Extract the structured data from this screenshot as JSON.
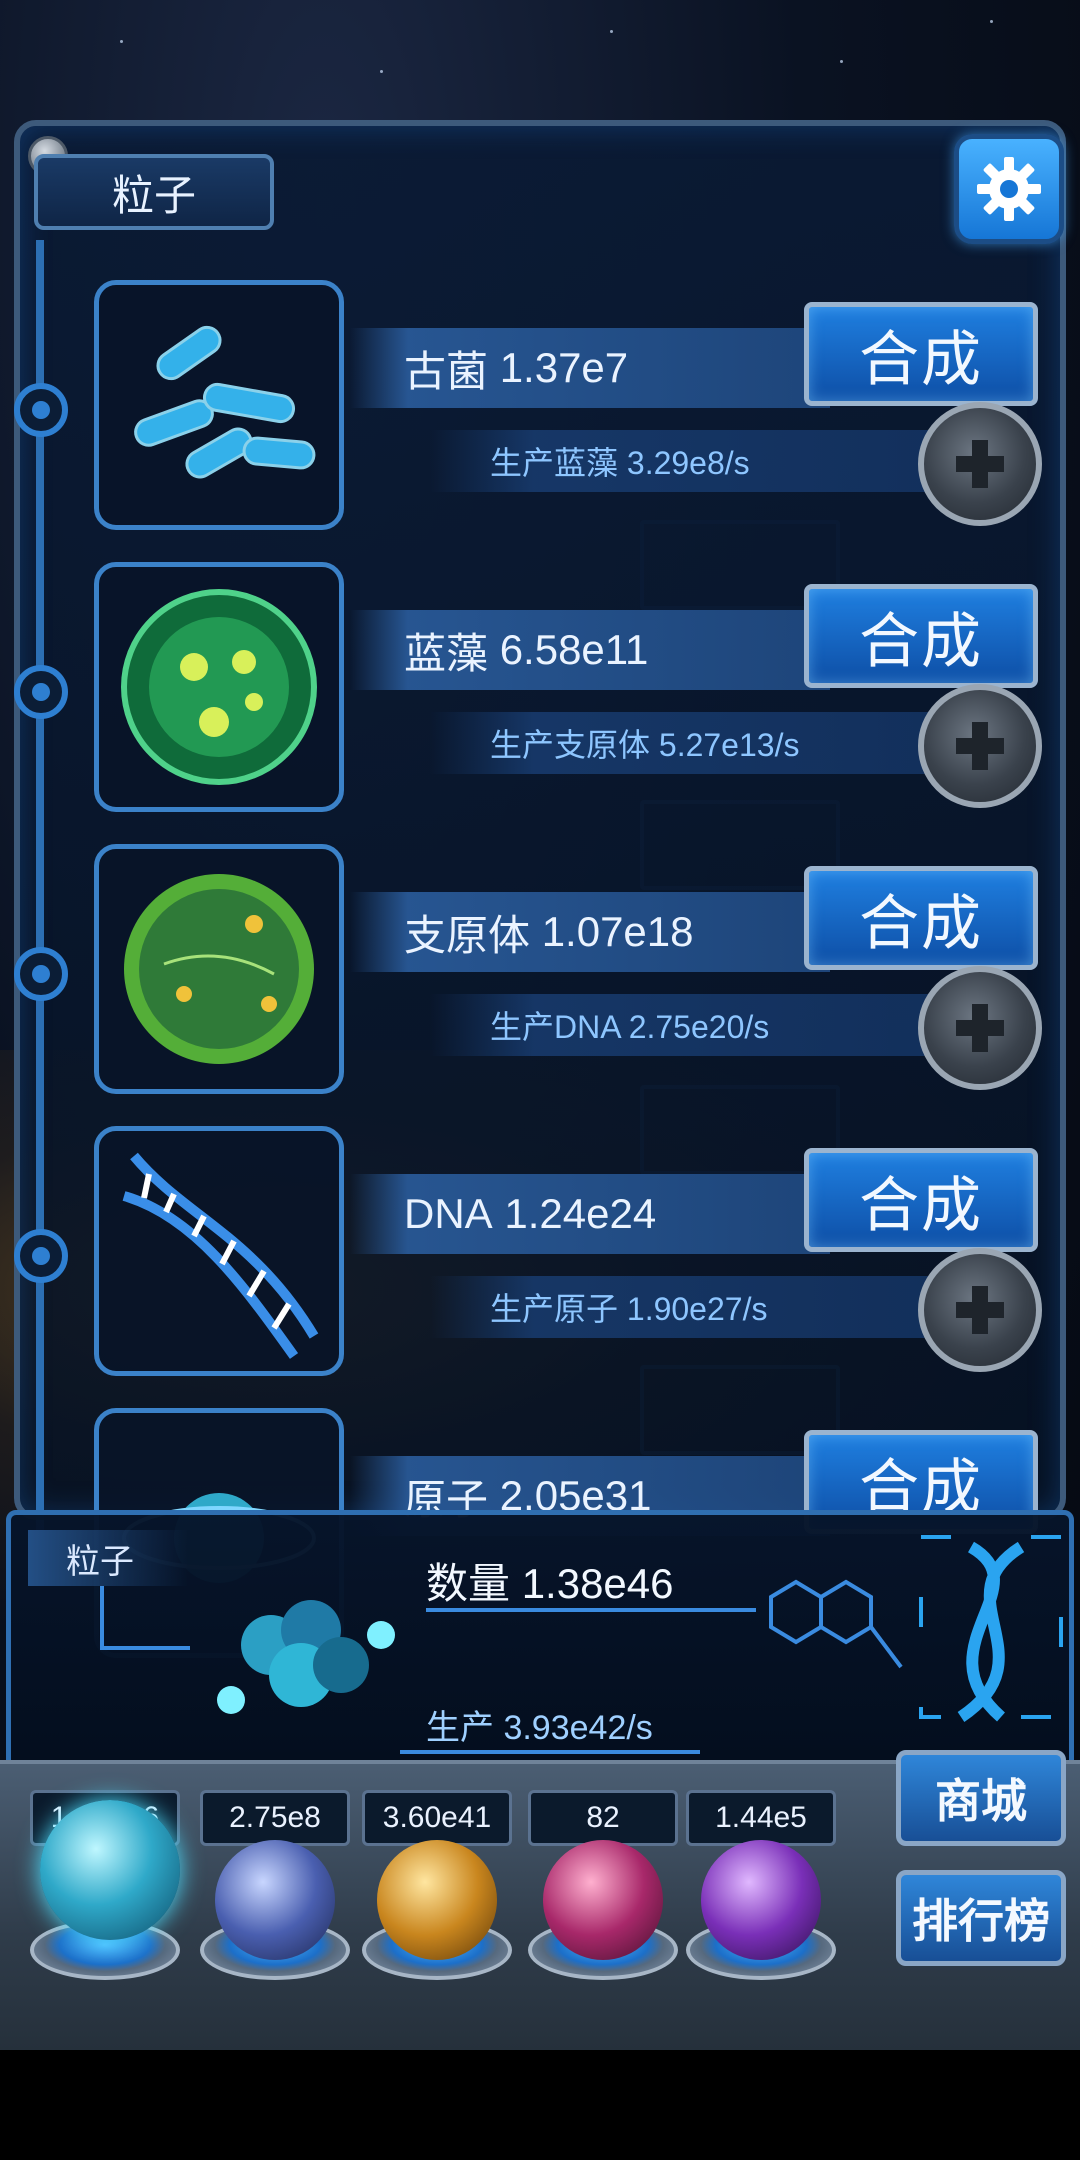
{
  "header": {
    "title": "粒子"
  },
  "creatures": [
    {
      "name": "古菌",
      "amount": "1.37e7",
      "production_text": "生产蓝藻 3.29e8/s",
      "synth_label": "合成"
    },
    {
      "name": "蓝藻",
      "amount": "6.58e11",
      "production_text": "生产支原体 5.27e13/s",
      "synth_label": "合成"
    },
    {
      "name": "支原体",
      "amount": "1.07e18",
      "production_text": "生产DNA 2.75e20/s",
      "synth_label": "合成"
    },
    {
      "name": "DNA",
      "amount": "1.24e24",
      "production_text": "生产原子 1.90e27/s",
      "synth_label": "合成"
    },
    {
      "name": "原子",
      "amount": "2.05e31",
      "production_text": "",
      "synth_label": "合成"
    }
  ],
  "particle_panel": {
    "label": "粒子",
    "count_label": "数量",
    "count_value": "1.38e46",
    "production_label": "生产",
    "production_value": "3.93e42/s"
  },
  "resources": [
    {
      "value": "1.38e46",
      "orb_color": "#2fa9c9"
    },
    {
      "value": "2.75e8",
      "orb_color": "#4a5fb0"
    },
    {
      "value": "3.60e41",
      "orb_color": "#c9861e"
    },
    {
      "value": "82",
      "orb_color": "#a8286a"
    },
    {
      "value": "1.44e5",
      "orb_color": "#7a2fb8"
    }
  ],
  "side_buttons": {
    "shop": "商城",
    "leaderboard": "排行榜"
  },
  "colors": {
    "accent": "#1f7fe0",
    "frame": "#3b82c9",
    "text_blue": "#8ec6ff"
  }
}
